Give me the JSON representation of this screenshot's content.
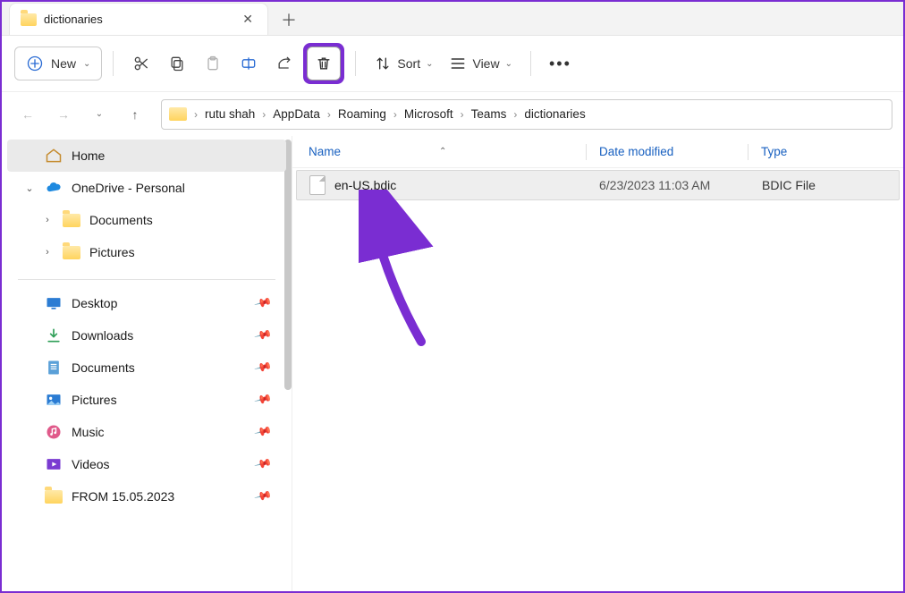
{
  "tab": {
    "title": "dictionaries"
  },
  "toolbar": {
    "new_label": "New",
    "sort_label": "Sort",
    "view_label": "View"
  },
  "breadcrumbs": {
    "items": [
      "rutu shah",
      "AppData",
      "Roaming",
      "Microsoft",
      "Teams",
      "dictionaries"
    ]
  },
  "sidebar": {
    "home": "Home",
    "onedrive": "OneDrive - Personal",
    "documents": "Documents",
    "pictures": "Pictures",
    "quick": {
      "desktop": "Desktop",
      "downloads": "Downloads",
      "documents": "Documents",
      "pictures": "Pictures",
      "music": "Music",
      "videos": "Videos",
      "from": "FROM 15.05.2023"
    }
  },
  "columns": {
    "name": "Name",
    "date": "Date modified",
    "type": "Type"
  },
  "files": {
    "rows": [
      {
        "name": "en-US.bdic",
        "date": "6/23/2023 11:03 AM",
        "type": "BDIC File"
      }
    ]
  },
  "annotation": {
    "highlight": "delete-button"
  }
}
